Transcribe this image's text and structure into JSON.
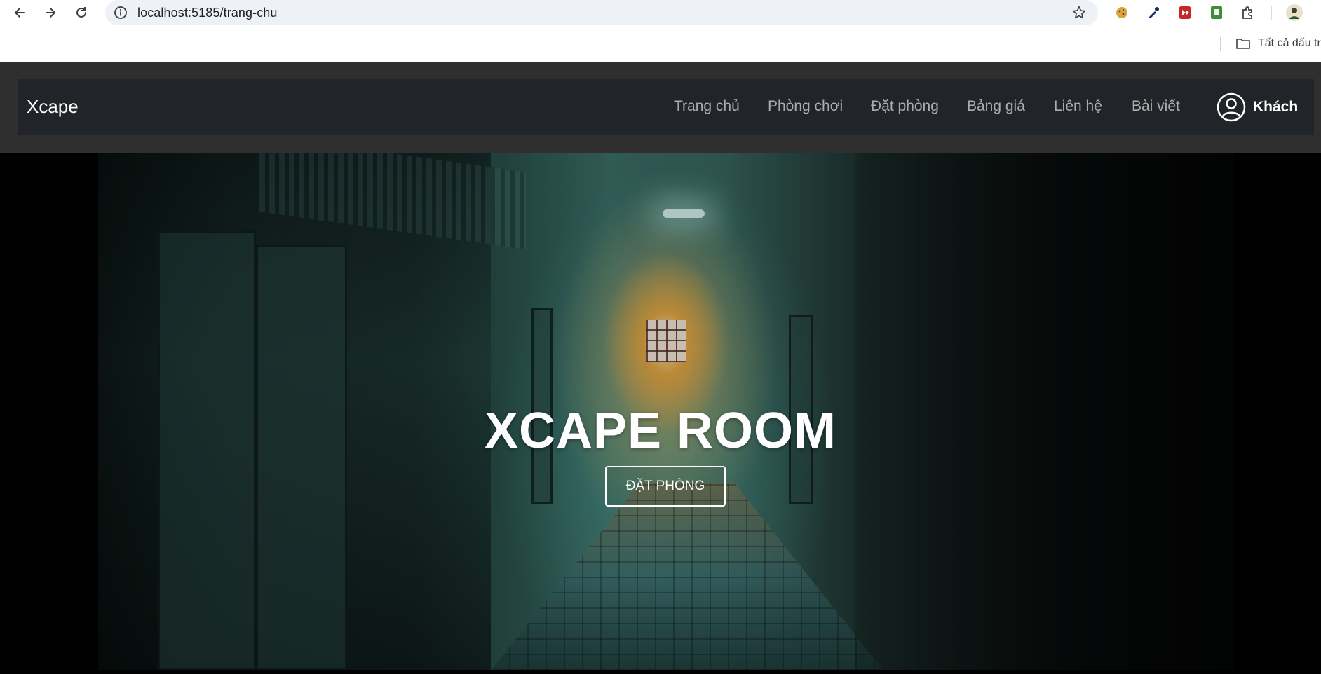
{
  "browser": {
    "url": "localhost:5185/trang-chu",
    "bookmarks_label": "Tất cả dấu tra",
    "icons": [
      "back-icon",
      "forward-icon",
      "reload-icon",
      "info-icon",
      "star-icon",
      "cookie-extension-icon",
      "eyedropper-extension-icon",
      "media-extension-icon",
      "green-extension-icon",
      "extensions-puzzle-icon",
      "profile-avatar",
      "folder-icon"
    ]
  },
  "navbar": {
    "brand": "Xcape",
    "menu": [
      "Trang chủ",
      "Phòng chơi",
      "Đặt phòng",
      "Bảng giá",
      "Liên hệ",
      "Bài viết"
    ],
    "user_label": "Khách"
  },
  "hero": {
    "title": "XCAPE ROOM",
    "button_label": "ĐẶT PHÒNG"
  },
  "colors": {
    "header_bg": "#2f2f30",
    "navbar_bg": "#212529",
    "menu_text": "rgba(255,255,255,0.62)",
    "hero_text": "#ffffff"
  }
}
